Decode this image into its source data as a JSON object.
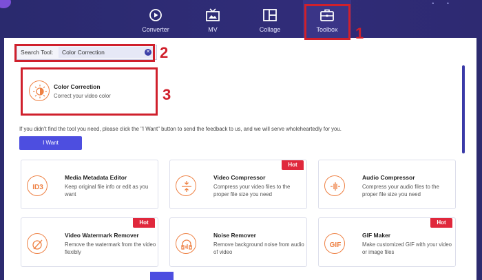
{
  "nav": {
    "tabs": [
      {
        "label": "Converter",
        "icon": "converter-icon"
      },
      {
        "label": "MV",
        "icon": "mv-icon"
      },
      {
        "label": "Collage",
        "icon": "collage-icon"
      },
      {
        "label": "Toolbox",
        "icon": "toolbox-icon",
        "active": true
      }
    ]
  },
  "annotations": [
    "1",
    "2",
    "3"
  ],
  "search": {
    "label": "Search Tool:",
    "value": "Color Correction"
  },
  "result": {
    "title": "Color Correction",
    "description": "Correct your video color",
    "icon": "color-correction-icon"
  },
  "feedback": {
    "text": "If you didn't find the tool you need, please click the \"I Want\" button to send the feedback to us, and we will serve wholeheartedly for you.",
    "button_label": "I Want"
  },
  "tools": [
    {
      "title": "Media Metadata Editor",
      "description": "Keep original file info or edit as you want",
      "icon": "id3-icon",
      "hot": false
    },
    {
      "title": "Video Compressor",
      "description": "Compress your video files to the proper file size you need",
      "icon": "video-compress-icon",
      "hot": true
    },
    {
      "title": "Audio Compressor",
      "description": "Compress your audio files to the proper file size you need",
      "icon": "audio-compress-icon",
      "hot": false
    },
    {
      "title": "Video Watermark Remover",
      "description": "Remove the watermark from the video flexibly",
      "icon": "watermark-remover-icon",
      "hot": true
    },
    {
      "title": "Noise Remover",
      "description": "Remove background noise from audio of video",
      "icon": "noise-remover-icon",
      "hot": false
    },
    {
      "title": "GIF Maker",
      "description": "Make customized GIF with your video or image files",
      "icon": "gif-icon",
      "hot": true
    }
  ],
  "hot_label": "Hot",
  "colors": {
    "accent": "#4d4ee0",
    "highlight": "#d0202c",
    "hot": "#e0283c",
    "icon": "#ee8144",
    "topbar": "#2d2b6f"
  }
}
